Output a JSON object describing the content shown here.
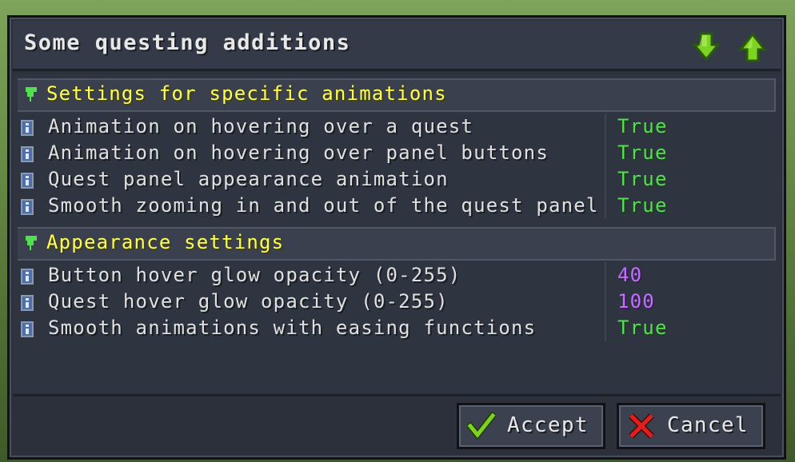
{
  "window": {
    "title": "Some questing additions",
    "scroll_down_icon": "arrow-down-icon",
    "scroll_up_icon": "arrow-up-icon"
  },
  "sections": [
    {
      "label": "Settings for specific animations",
      "items": [
        {
          "name": "Animation on hovering over a quest",
          "value": "True",
          "type": "boolean"
        },
        {
          "name": "Animation on hovering over panel buttons",
          "value": "True",
          "type": "boolean"
        },
        {
          "name": "Quest panel appearance animation",
          "value": "True",
          "type": "boolean"
        },
        {
          "name": "Smooth zooming in and out of the quest panel",
          "value": "True",
          "type": "boolean"
        }
      ]
    },
    {
      "label": "Appearance settings",
      "items": [
        {
          "name": "Button hover glow opacity (0-255)",
          "value": "40",
          "type": "number"
        },
        {
          "name": "Quest hover glow opacity (0-255)",
          "value": "100",
          "type": "number"
        },
        {
          "name": "Smooth animations with easing functions",
          "value": "True",
          "type": "boolean"
        }
      ]
    }
  ],
  "footer": {
    "accept_label": "Accept",
    "cancel_label": "Cancel"
  },
  "colors": {
    "section_label": "#ffff55",
    "bool_value": "#55dd55",
    "number_value": "#c070ff",
    "accent_green": "#7ed321",
    "cancel_red": "#e02020"
  }
}
